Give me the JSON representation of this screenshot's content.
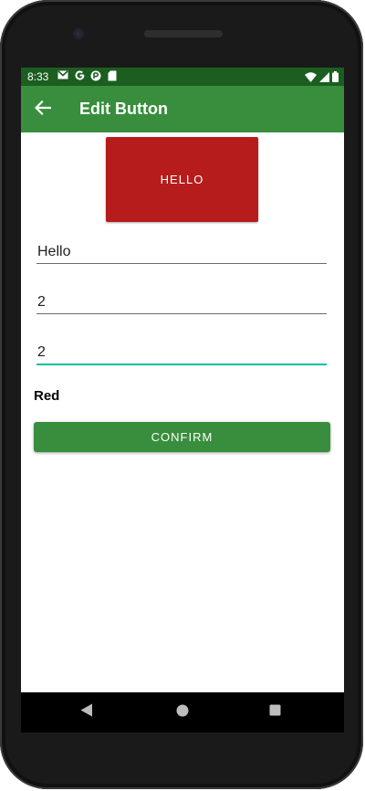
{
  "status_bar": {
    "time": "8:33",
    "left_icons": [
      "gmail-icon",
      "google-icon",
      "app-notification-icon",
      "sd-card-icon"
    ],
    "right_icons": [
      "wifi-icon",
      "cellular-signal-icon",
      "battery-icon"
    ],
    "background_color": "#1b5e20"
  },
  "app_bar": {
    "title": "Edit Button",
    "back_icon": "arrow-left-icon",
    "background_color": "#388e3c"
  },
  "preview": {
    "label": "HELLO",
    "background_color": "#b71c1c"
  },
  "form": {
    "text_value": "Hello",
    "field_two_value": "2",
    "field_three_value": "2",
    "color_name": "Red",
    "confirm_label": "CONFIRM",
    "focus_color": "#00bfa5"
  },
  "nav_bar": {
    "buttons": [
      "back-triangle-icon",
      "home-circle-icon",
      "recents-square-icon"
    ]
  }
}
